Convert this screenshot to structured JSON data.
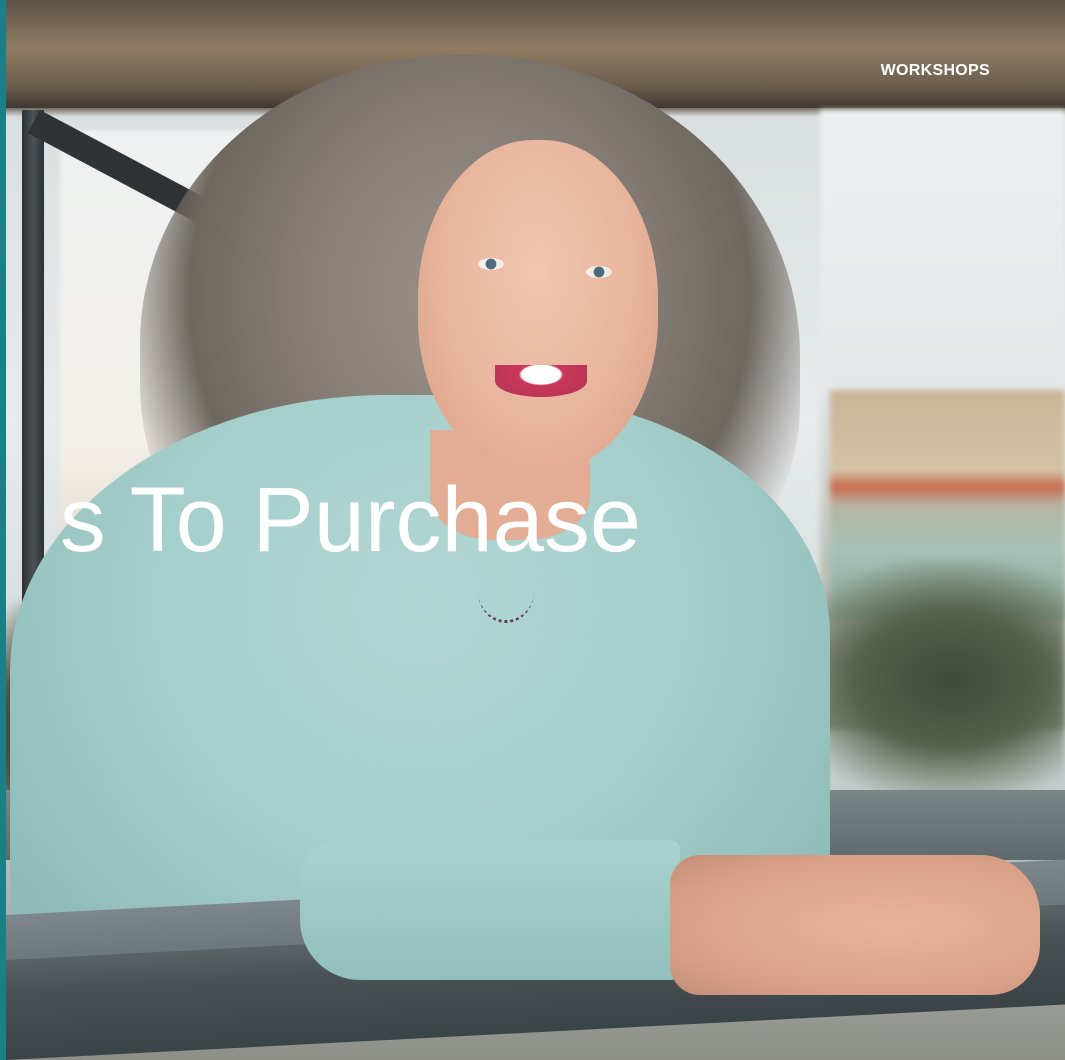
{
  "nav": {
    "workshops_label": "WORKSHOPS"
  },
  "hero": {
    "headline": "Books To Purchase",
    "visible_headline": "s To Purchase",
    "photo": "portrait-of-smiling-woman-with-curly-gray-hair-leaning-on-railing"
  },
  "colors": {
    "left_edge_accent": "#1a7f86",
    "text": "#ffffff",
    "sweater": "#a5cfcb"
  }
}
